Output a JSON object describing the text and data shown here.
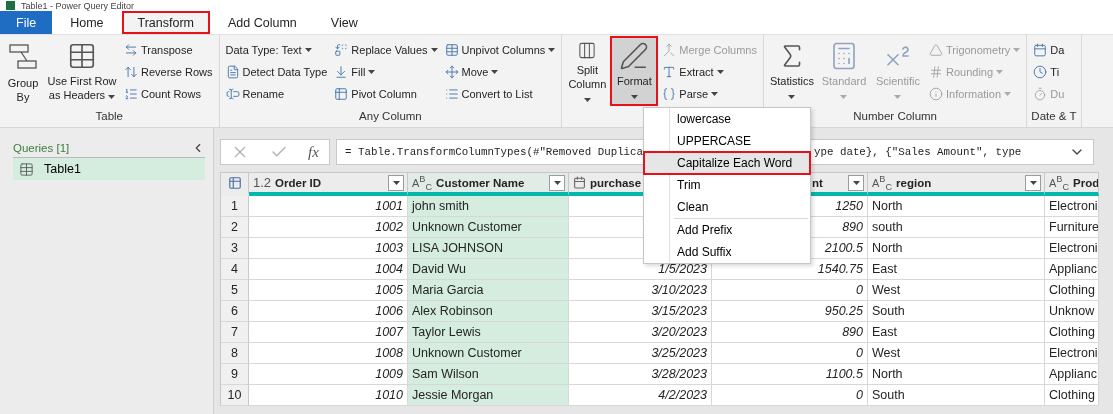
{
  "window": {
    "title": "Table1 - Power Query Editor"
  },
  "tabs": [
    {
      "label": "File",
      "kind": "file",
      "selected": false,
      "highlighted": false
    },
    {
      "label": "Home",
      "kind": "tab",
      "selected": false,
      "highlighted": false
    },
    {
      "label": "Transform",
      "kind": "tab",
      "selected": true,
      "highlighted": true
    },
    {
      "label": "Add Column",
      "kind": "tab",
      "selected": false,
      "highlighted": false
    },
    {
      "label": "View",
      "kind": "tab",
      "selected": false,
      "highlighted": false
    }
  ],
  "ribbon": {
    "groups": [
      {
        "label": "Table",
        "controls": [
          {
            "kind": "large",
            "label": "Group By",
            "dropdown": false,
            "disabled": false,
            "pressed": false,
            "highlighted": false
          },
          {
            "kind": "large",
            "label": "Use First Row as Headers",
            "dropdown": true,
            "disabled": false,
            "pressed": false,
            "highlighted": false
          },
          {
            "kind": "stack",
            "items": [
              {
                "label": "Transpose",
                "dropdown": false,
                "disabled": false
              },
              {
                "label": "Reverse Rows",
                "dropdown": false,
                "disabled": false
              },
              {
                "label": "Count Rows",
                "dropdown": false,
                "disabled": false
              }
            ]
          }
        ]
      },
      {
        "label": "Any Column",
        "controls": [
          {
            "kind": "stack",
            "items": [
              {
                "label": "Data Type: Text",
                "dropdown": true,
                "disabled": false
              },
              {
                "label": "Detect Data Type",
                "dropdown": false,
                "disabled": false
              },
              {
                "label": "Rename",
                "dropdown": false,
                "disabled": false
              }
            ]
          },
          {
            "kind": "stack",
            "items": [
              {
                "label": "Replace Values",
                "dropdown": true,
                "disabled": false
              },
              {
                "label": "Fill",
                "dropdown": true,
                "disabled": false
              },
              {
                "label": "Pivot Column",
                "dropdown": false,
                "disabled": false
              }
            ]
          },
          {
            "kind": "stack",
            "items": [
              {
                "label": "Unpivot Columns",
                "dropdown": true,
                "disabled": false
              },
              {
                "label": "Move",
                "dropdown": true,
                "disabled": false
              },
              {
                "label": "Convert to List",
                "dropdown": false,
                "disabled": false
              }
            ]
          }
        ]
      },
      {
        "controls": [
          {
            "kind": "large",
            "label": "Split Column",
            "dropdown": true,
            "disabled": false,
            "pressed": false,
            "highlighted": false
          },
          {
            "kind": "large",
            "label": "Format",
            "dropdown": true,
            "disabled": false,
            "pressed": true,
            "highlighted": true
          },
          {
            "kind": "stack",
            "items": [
              {
                "label": "Merge Columns",
                "dropdown": false,
                "disabled": true
              },
              {
                "label": "Extract",
                "dropdown": true,
                "disabled": false
              },
              {
                "label": "Parse",
                "dropdown": true,
                "disabled": false
              }
            ]
          }
        ]
      },
      {
        "label": "Number Column",
        "controls": [
          {
            "kind": "large",
            "label": "Statistics",
            "dropdown": true,
            "disabled": false,
            "pressed": false,
            "highlighted": false
          },
          {
            "kind": "large",
            "label": "Standard",
            "dropdown": true,
            "disabled": true,
            "pressed": false,
            "highlighted": false
          },
          {
            "kind": "large",
            "label": "Scientific",
            "dropdown": true,
            "disabled": true,
            "pressed": false,
            "highlighted": false
          },
          {
            "kind": "stack",
            "items": [
              {
                "label": "Trigonometry",
                "dropdown": true,
                "disabled": true
              },
              {
                "label": "Rounding",
                "dropdown": true,
                "disabled": true
              },
              {
                "label": "Information",
                "dropdown": true,
                "disabled": true
              }
            ]
          }
        ]
      },
      {
        "label": "Date & T",
        "controls": [
          {
            "kind": "stack",
            "items": [
              {
                "label": "Da",
                "dropdown": false,
                "disabled": false
              },
              {
                "label": "Ti",
                "dropdown": false,
                "disabled": false
              },
              {
                "label": "Du",
                "dropdown": false,
                "disabled": true
              }
            ]
          }
        ]
      }
    ]
  },
  "queries": {
    "title": "Queries [1]",
    "items": [
      {
        "label": "Table1",
        "selected": true
      }
    ]
  },
  "formula_bar": {
    "fx_label": "fx",
    "formula_start": "= Table.TransformColumnTypes(#\"Removed Duplica",
    "formula_end": "ype date}, {\"Sales Amount\", type"
  },
  "table": {
    "columns": [
      {
        "kind": "number",
        "type_label": "1.2",
        "label": "Order ID",
        "selected": false,
        "filter": true
      },
      {
        "kind": "text",
        "type_label": "A$^{B}$$_{C}$",
        "label": "Customer Name",
        "selected": true,
        "filter": true
      },
      {
        "kind": "date",
        "label": "purchase",
        "selected": false
      },
      {
        "kind": "number",
        "label": "nt",
        "selected": false,
        "filter": true
      },
      {
        "kind": "text",
        "type_label": "A$^{B}$$_{C}$",
        "label": "region",
        "selected": false,
        "filter": true
      },
      {
        "kind": "text",
        "type_label": "A$^{B}$$_{C}$",
        "label": "Prod",
        "selected": false
      }
    ],
    "rows": [
      {
        "number": "1",
        "cells": [
          "1001",
          "john smith",
          null,
          "1250",
          "North",
          "Electroni"
        ]
      },
      {
        "number": "2",
        "cells": [
          "1002",
          "Unknown Customer",
          null,
          "890",
          "south",
          "Furniture"
        ]
      },
      {
        "number": "3",
        "cells": [
          "1003",
          "LISA JOHNSON",
          null,
          "2100.5",
          "North",
          "Electroni"
        ]
      },
      {
        "number": "4",
        "cells": [
          "1004",
          "David Wu",
          "1/5/2023",
          "1540.75",
          "East",
          "Applianc"
        ]
      },
      {
        "number": "5",
        "cells": [
          "1005",
          "Maria Garcia",
          "3/10/2023",
          "0",
          "West",
          "Clothing"
        ]
      },
      {
        "number": "6",
        "cells": [
          "1006",
          "Alex Robinson",
          "3/15/2023",
          "950.25",
          "South",
          "Unknow"
        ]
      },
      {
        "number": "7",
        "cells": [
          "1007",
          "Taylor Lewis",
          "3/20/2023",
          "890",
          "East",
          "Clothing"
        ]
      },
      {
        "number": "8",
        "cells": [
          "1008",
          "Unknown Customer",
          "3/25/2023",
          "0",
          "West",
          "Electroni"
        ]
      },
      {
        "number": "9",
        "cells": [
          "1009",
          "Sam Wilson",
          "3/28/2023",
          "1100.5",
          "North",
          "Applianc"
        ]
      },
      {
        "number": "10",
        "cells": [
          "1010",
          "Jessie Morgan",
          "4/2/2023",
          "0",
          "South",
          "Clothing"
        ]
      }
    ]
  },
  "format_menu": {
    "items": [
      {
        "kind": "item",
        "label": "lowercase",
        "selected": false,
        "highlighted": false
      },
      {
        "kind": "item",
        "label": "UPPERCASE",
        "selected": false,
        "highlighted": false
      },
      {
        "kind": "item",
        "label": "Capitalize Each Word",
        "selected": true,
        "highlighted": true
      },
      {
        "kind": "item",
        "label": "Trim",
        "selected": false,
        "highlighted": false
      },
      {
        "kind": "item",
        "label": "Clean",
        "selected": false,
        "highlighted": false
      },
      {
        "kind": "separator"
      },
      {
        "kind": "item",
        "label": "Add Prefix",
        "selected": false,
        "highlighted": false
      },
      {
        "kind": "item",
        "label": "Add Suffix",
        "selected": false,
        "highlighted": false
      }
    ]
  }
}
